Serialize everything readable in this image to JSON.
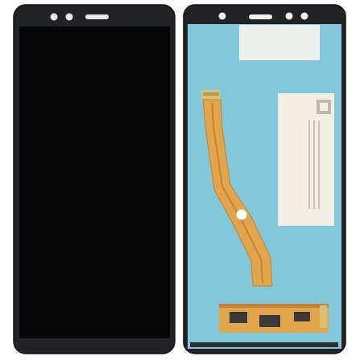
{
  "scene": {
    "subject": "phone-display-assembly",
    "views": [
      "front",
      "back"
    ],
    "colors": {
      "background": "#ffffff",
      "frame": "#222325",
      "frame_edge": "#111214",
      "screen": "#050505",
      "back_panel": "#7dc3d8",
      "back_panel_light": "#8fcde0",
      "paper_sticker": "#f3eee3",
      "label": "#eef0ee",
      "flex_cable": "#e1a64c",
      "flex_cable_dark": "#c28433",
      "connector": "#d9c07a",
      "component": "#3a3a3a"
    }
  }
}
